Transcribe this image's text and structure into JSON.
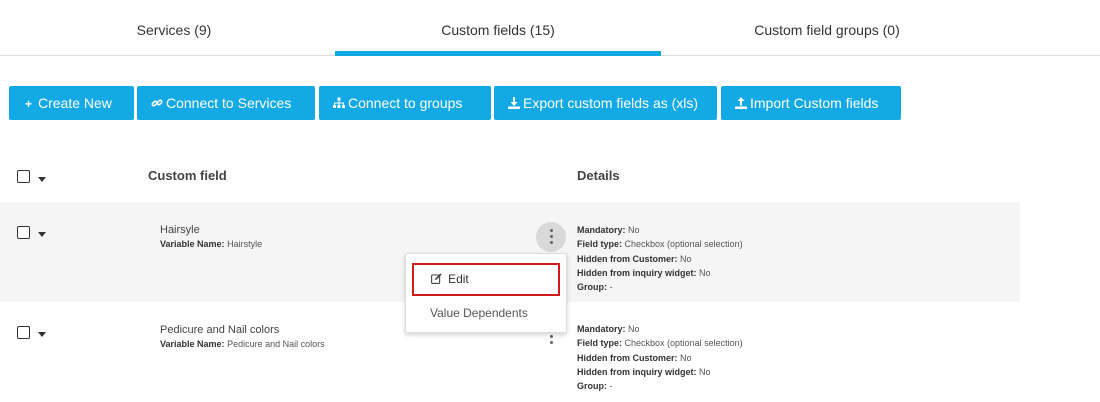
{
  "tabs": [
    {
      "label": "Services (9)"
    },
    {
      "label": "Custom fields (15)",
      "active": true
    },
    {
      "label": "Custom field groups (0)"
    }
  ],
  "toolbar": {
    "create_new": "Create New",
    "connect_services": "Connect to Services",
    "connect_groups": "Connect to groups",
    "export": "Export custom fields as (xls)",
    "import": "Import Custom fields"
  },
  "table": {
    "headers": {
      "custom_field": "Custom field",
      "details": "Details"
    },
    "detail_labels": {
      "mandatory": "Mandatory:",
      "field_type": "Field type:",
      "hidden_customer": "Hidden from Customer:",
      "hidden_inquiry": "Hidden from inquiry widget:",
      "group": "Group:"
    },
    "variable_label": "Variable Name:",
    "rows": [
      {
        "name": "Hairsyle",
        "variable": "Hairstyle",
        "mandatory": "No",
        "field_type": "Checkbox (optional selection)",
        "hidden_customer": "No",
        "hidden_inquiry": "No",
        "group": "-"
      },
      {
        "name": "Pedicure and Nail colors",
        "variable": "Pedicure and Nail colors",
        "mandatory": "No",
        "field_type": "Checkbox (optional selection)",
        "hidden_customer": "No",
        "hidden_inquiry": "No",
        "group": "-"
      }
    ]
  },
  "menu": {
    "edit": "Edit",
    "value_dependents": "Value Dependents"
  },
  "colors": {
    "accent": "#13a9e5",
    "highlight": "#d01b1b"
  }
}
